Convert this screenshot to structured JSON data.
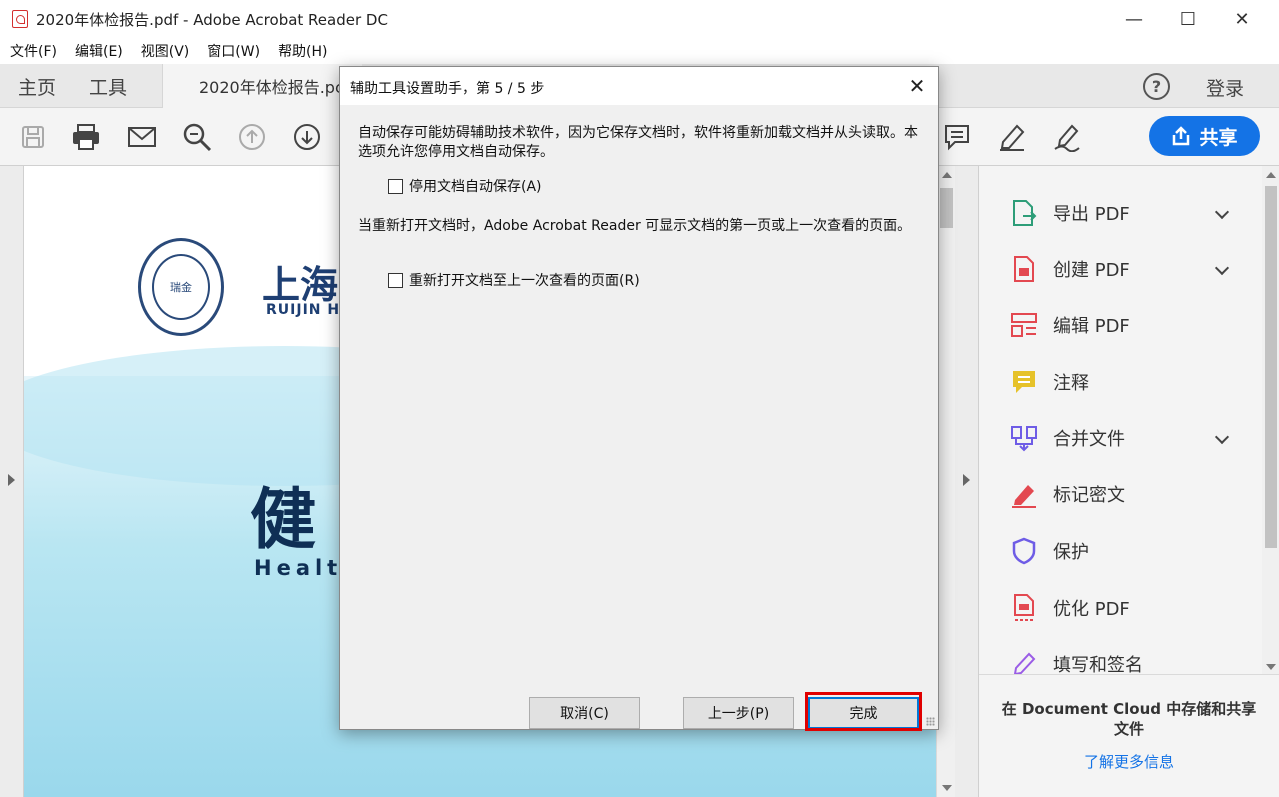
{
  "window": {
    "title": "2020年体检报告.pdf - Adobe Acrobat Reader DC",
    "minimize": "—",
    "maximize": "☐",
    "close": "✕"
  },
  "menu": [
    "文件(F)",
    "编辑(E)",
    "视图(V)",
    "窗口(W)",
    "帮助(H)"
  ],
  "tabs": {
    "home": "主页",
    "tools": "工具",
    "document": "2020年体检报告.pc",
    "help": "?",
    "login": "登录"
  },
  "toolbar": {
    "share_label": "共享"
  },
  "document": {
    "seal_text": "瑞金",
    "hospital_name": "上海",
    "hospital_en": "RUIJIN HO",
    "health_title": "健",
    "health_en": "Healt"
  },
  "right_pane": {
    "items": [
      {
        "label": "导出 PDF",
        "icon": "export-pdf-icon",
        "expandable": true,
        "color": "#2d9d78"
      },
      {
        "label": "创建 PDF",
        "icon": "create-pdf-icon",
        "expandable": true,
        "color": "#e34850"
      },
      {
        "label": "编辑 PDF",
        "icon": "edit-pdf-icon",
        "expandable": false,
        "color": "#e34850"
      },
      {
        "label": "注释",
        "icon": "comment-icon",
        "expandable": false,
        "color": "#e6c229"
      },
      {
        "label": "合并文件",
        "icon": "combine-files-icon",
        "expandable": true,
        "color": "#6e5ce6"
      },
      {
        "label": "标记密文",
        "icon": "redact-icon",
        "expandable": false,
        "color": "#e34850"
      },
      {
        "label": "保护",
        "icon": "protect-icon",
        "expandable": false,
        "color": "#6e5ce6"
      },
      {
        "label": "优化 PDF",
        "icon": "optimize-pdf-icon",
        "expandable": false,
        "color": "#e34850"
      },
      {
        "label": "填写和签名",
        "icon": "fill-sign-icon",
        "expandable": false,
        "color": "#9a5ce6"
      }
    ],
    "cloud_text": "在 Document Cloud 中存储和共享文件",
    "cloud_link": "了解更多信息"
  },
  "dialog": {
    "title": "辅助工具设置助手，第 5 / 5 步",
    "close": "✕",
    "para1": "自动保存可能妨碍辅助技术软件，因为它保存文档时，软件将重新加载文档并从头读取。本选项允许您停用文档自动保存。",
    "check1": "停用文档自动保存(A)",
    "check1_checked": false,
    "para2": "当重新打开文档时，Adobe Acrobat Reader 可显示文档的第一页或上一次查看的页面。",
    "check2": "重新打开文档至上一次查看的页面(R)",
    "check2_checked": false,
    "cancel": "取消(C)",
    "back": "上一步(P)",
    "finish": "完成"
  },
  "colors": {
    "accent": "#1473e6",
    "highlight": "#e00000"
  }
}
